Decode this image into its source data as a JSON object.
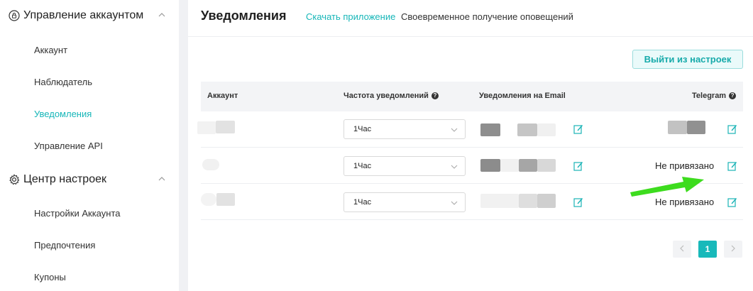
{
  "sidebar": {
    "sections": [
      {
        "title": "Управление аккаунтом",
        "icon": "lock-icon",
        "items": [
          {
            "label": "Аккаунт",
            "active": false
          },
          {
            "label": "Наблюдатель",
            "active": false
          },
          {
            "label": "Уведомления",
            "active": true
          },
          {
            "label": "Управление API",
            "active": false
          }
        ]
      },
      {
        "title": "Центр настроек",
        "icon": "gear-icon",
        "items": [
          {
            "label": "Настройки Аккаунта",
            "active": false
          },
          {
            "label": "Предпочтения",
            "active": false
          },
          {
            "label": "Купоны",
            "active": false
          }
        ]
      }
    ]
  },
  "header": {
    "title": "Уведомления",
    "download_link": "Скачать приложение",
    "description": "Своевременное получение оповещений"
  },
  "exit_button": "Выйти из настроек",
  "table": {
    "columns": {
      "account": "Аккаунт",
      "frequency": "Частота уведомлений",
      "email": "Уведомления на Email",
      "telegram": "Telegram"
    },
    "rows": [
      {
        "frequency": "1Час",
        "telegram": ""
      },
      {
        "frequency": "1Час",
        "telegram": "Не привязано"
      },
      {
        "frequency": "1Час",
        "telegram": "Не привязано"
      }
    ]
  },
  "pagination": {
    "current": "1",
    "prev_icon": "chevron-left-icon",
    "next_icon": "chevron-right-icon"
  },
  "colors": {
    "accent": "#16b6b8",
    "annotation_arrow": "#3ddc1e"
  }
}
